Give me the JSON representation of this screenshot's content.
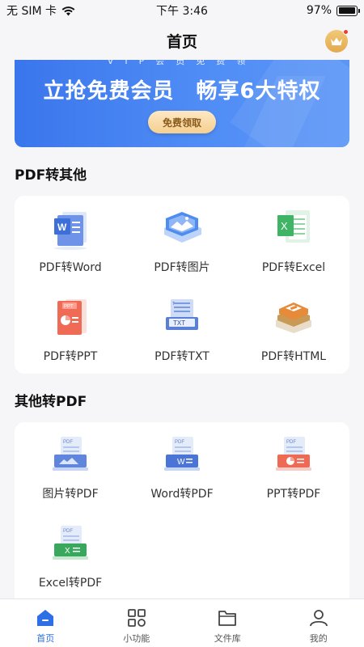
{
  "status_bar": {
    "carrier": "无 SIM 卡",
    "time": "下午 3:46",
    "battery": "97%",
    "battery_level": 0.97
  },
  "header": {
    "title": "首页",
    "crown_icon": "crown-icon"
  },
  "banner": {
    "subtitle": "VIP会员免费领",
    "title": "立抢免费会员　畅享6大特权",
    "button_label": "免费领取",
    "colors": {
      "start": "#3a76ec",
      "end": "#5b96f7",
      "button": "#f5cf8f"
    }
  },
  "section_pdf_to_other": {
    "title": "PDF转其他",
    "items": [
      {
        "label": "PDF转Word",
        "icon": "pdf-to-word-icon"
      },
      {
        "label": "PDF转图片",
        "icon": "pdf-to-image-icon"
      },
      {
        "label": "PDF转Excel",
        "icon": "pdf-to-excel-icon"
      },
      {
        "label": "PDF转PPT",
        "icon": "pdf-to-ppt-icon"
      },
      {
        "label": "PDF转TXT",
        "icon": "pdf-to-txt-icon"
      },
      {
        "label": "PDF转HTML",
        "icon": "pdf-to-html-icon"
      }
    ]
  },
  "section_other_to_pdf": {
    "title": "其他转PDF",
    "items": [
      {
        "label": "图片转PDF",
        "icon": "image-to-pdf-icon"
      },
      {
        "label": "Word转PDF",
        "icon": "word-to-pdf-icon"
      },
      {
        "label": "PPT转PDF",
        "icon": "ppt-to-pdf-icon"
      },
      {
        "label": "Excel转PDF",
        "icon": "excel-to-pdf-icon"
      }
    ]
  },
  "tabbar": {
    "active_color": "#2f6fe6",
    "tabs": [
      {
        "label": "首页",
        "icon": "home-icon",
        "active": true
      },
      {
        "label": "小功能",
        "icon": "grid-icon",
        "active": false
      },
      {
        "label": "文件库",
        "icon": "folder-icon",
        "active": false
      },
      {
        "label": "我的",
        "icon": "profile-icon",
        "active": false
      }
    ]
  }
}
